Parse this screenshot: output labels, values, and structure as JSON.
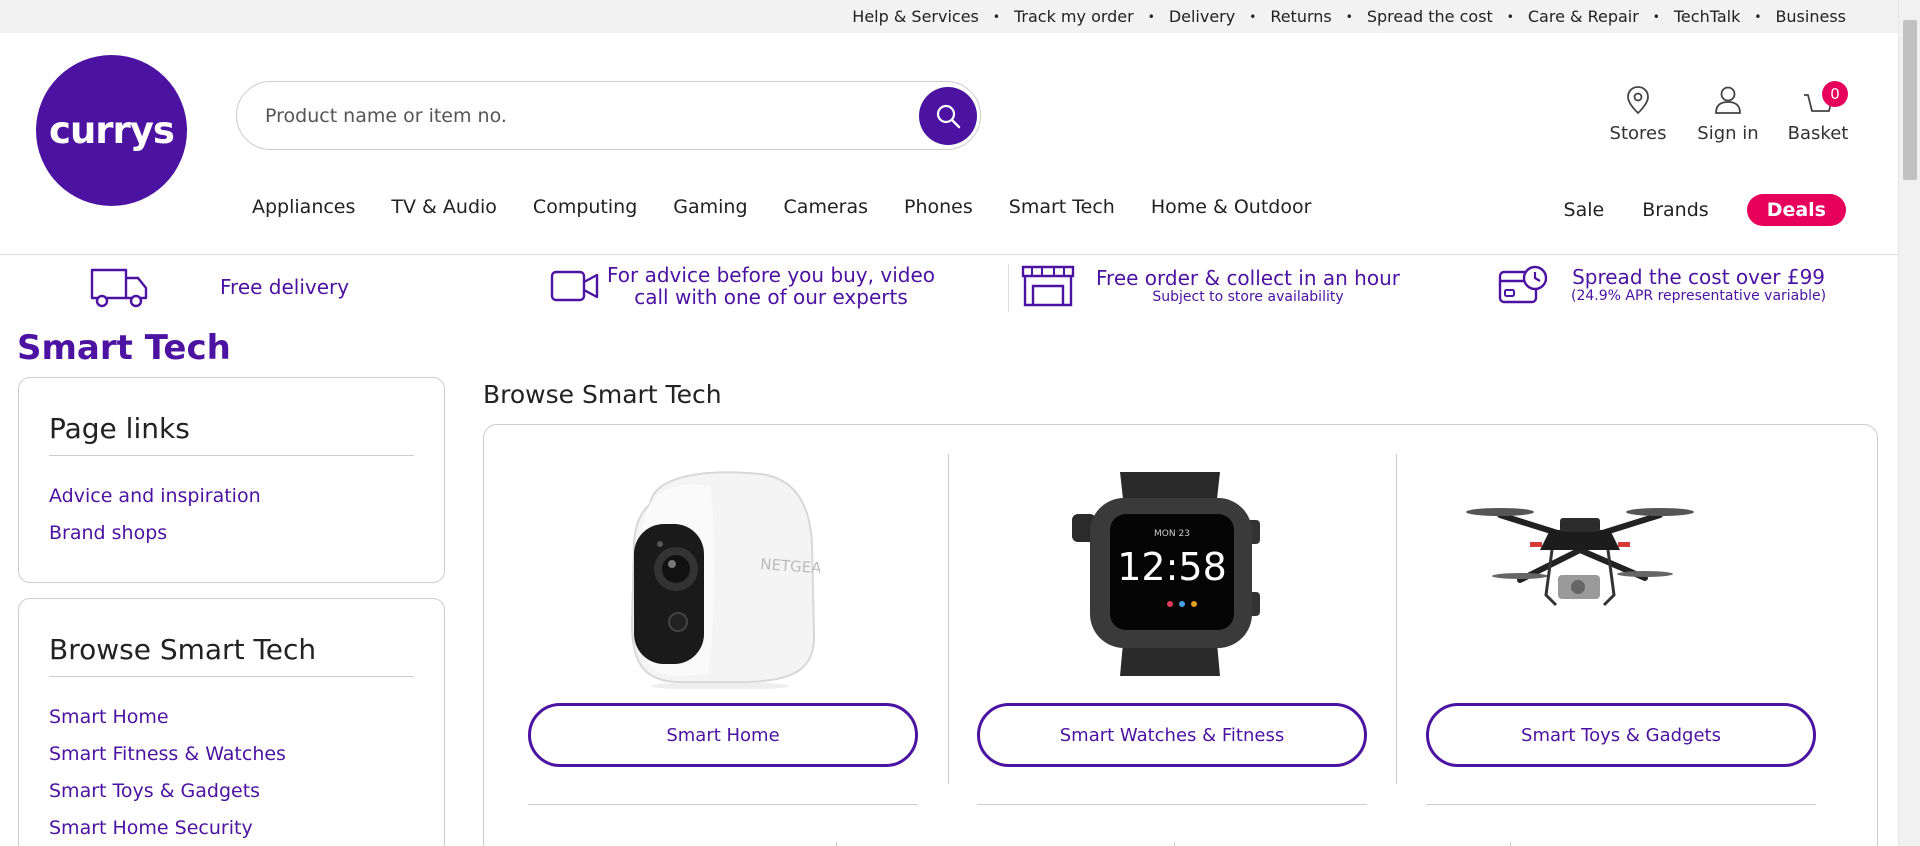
{
  "top_links": [
    "Help & Services",
    "Track my order",
    "Delivery",
    "Returns",
    "Spread the cost",
    "Care & Repair",
    "TechTalk",
    "Business"
  ],
  "logo": {
    "text": "currys"
  },
  "search": {
    "placeholder": "Product name or item no."
  },
  "header_utils": {
    "stores": "Stores",
    "sign_in": "Sign in",
    "basket": "Basket",
    "basket_count": "0"
  },
  "nav": {
    "items": [
      "Appliances",
      "TV & Audio",
      "Computing",
      "Gaming",
      "Cameras",
      "Phones",
      "Smart Tech",
      "Home & Outdoor"
    ],
    "right": [
      "Sale",
      "Brands",
      "Deals"
    ]
  },
  "usp": [
    {
      "icon": "delivery-van-icon",
      "line1": "Free delivery",
      "line2": ""
    },
    {
      "icon": "video-call-icon",
      "line1": "For advice before you buy, video",
      "line2": "call with one of our experts"
    },
    {
      "icon": "store-icon",
      "line1": "Free order & collect in an hour",
      "line2": "Subject to store availability"
    },
    {
      "icon": "credit-card-clock-icon",
      "line1": "Spread the cost over £99",
      "line2": "(24.9% APR representative variable)"
    }
  ],
  "page_title": "Smart Tech",
  "page_links": {
    "heading": "Page links",
    "links": [
      "Advice and inspiration",
      "Brand shops"
    ]
  },
  "browse_side": {
    "heading": "Browse Smart Tech",
    "links": [
      "Smart Home",
      "Smart Fitness & Watches",
      "Smart Toys & Gadgets",
      "Smart Home Security"
    ]
  },
  "browse_main": {
    "heading": "Browse Smart Tech",
    "cards": [
      {
        "label": "Smart Home",
        "image": "security-camera-image"
      },
      {
        "label": "Smart Watches & Fitness",
        "image": "smartwatch-image",
        "watch_time": "12:58",
        "watch_date": "MON 23"
      },
      {
        "label": "Smart Toys & Gadgets",
        "image": "drone-image"
      }
    ]
  },
  "colors": {
    "brand": "#4c12a1",
    "accent": "#e6005b"
  }
}
